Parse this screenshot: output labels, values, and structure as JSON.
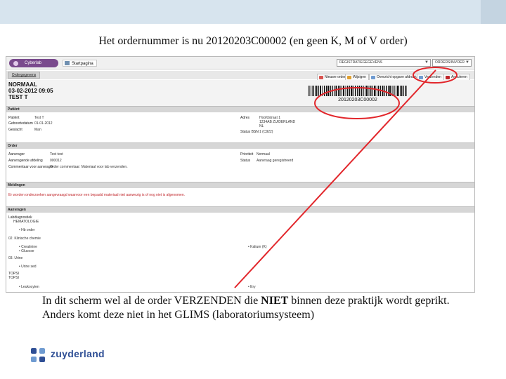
{
  "slide": {
    "headline": "Het ordernummer is nu 20120203C00002 (en geen K, M of V order)",
    "caption_part1": "In dit scherm wel al de order VERZENDEN die ",
    "caption_bold": "NIET",
    "caption_part2": " binnen deze praktijk wordt geprikt. Anders komt deze niet in het GLIMS (laboratoriumsysteem)",
    "brand_name": "zuyderland",
    "accent_red": "#e2262b",
    "brand_blue": "#2f4f95"
  },
  "app": {
    "logo_text": "Cyberlab",
    "home_label": "Startpagina",
    "dropdown1_label": "REGISTRATIEGEGEVENS",
    "dropdown2_label": "ORDERS/INVOER",
    "tab_label": "Ordergegevens",
    "toolbar": [
      {
        "label": "Nieuwe order",
        "icon": "new-icon",
        "color": "#d9534f"
      },
      {
        "label": "Wijzigen",
        "icon": "edit-icon",
        "color": "#e0a030"
      },
      {
        "label": "Overzicht opgave afdrukken",
        "icon": "print-icon",
        "color": "#6f9bd1"
      },
      {
        "label": "Verzenden",
        "icon": "send-icon",
        "color": "#6f9bd1"
      },
      {
        "label": "Annuleren",
        "icon": "cancel-icon",
        "color": "#c0262b"
      }
    ],
    "status_line": "NORMAAL",
    "datetime_line": "03-02-2012 09:05",
    "patient_line": "TEST T",
    "barcode_text": "20120203C00002",
    "sections": {
      "patient": "Patiënt",
      "order": "Order",
      "warnings": "Meldingen",
      "requests": "Aanvragen"
    },
    "patient": {
      "name_label": "Patiënt",
      "name_value": "Test T",
      "dob_label": "Geboortedatum",
      "dob_value": "01-01-2012",
      "sex_label": "Geslacht",
      "sex_value": "Man",
      "address_label": "Adres",
      "address_value": "Hoofdstraat 1",
      "address_value2": "1234AB ZUIDERLAND",
      "address_value3": "NL",
      "bsn_label": "Status BSN",
      "bsn_value": "1 (C922)"
    },
    "order": {
      "requester_label": "Aanvrager",
      "requester_value": "Test test",
      "priority_label": "Prioriteit",
      "priority_value": "Normaal",
      "dept_label": "Aanvragende afdeling",
      "dept_value": "000012",
      "status_label": "Status",
      "status_value": "Aanvraag geregistreerd",
      "comment_label": "Commentaar voor aanvrager",
      "comment_value": "Order commentaar: Materiaal voor lab verzenden."
    },
    "warning_text": "Er worden onderzoeken aangevraagd waarvoor een bepaald materiaal niet aanwezig is of nog niet is afgenomen.",
    "requests": {
      "group1_title": "Labdiagnostiek",
      "group1_sub": "HEMATOLOGIE",
      "group1_items": [
        "Hb order"
      ],
      "group2_title": "02. Klinische chemie",
      "group2_items": [
        "Creatinine",
        "Glucose"
      ],
      "group2_right": "Kalium (K)",
      "group3_title": "03. Urine",
      "group3_items": [
        "Urine sed"
      ],
      "group4_title": "TOPSI",
      "group4_sub": "TOPSI",
      "group4_items": [
        "Leukocyten"
      ],
      "group4_right": "Ery"
    }
  }
}
